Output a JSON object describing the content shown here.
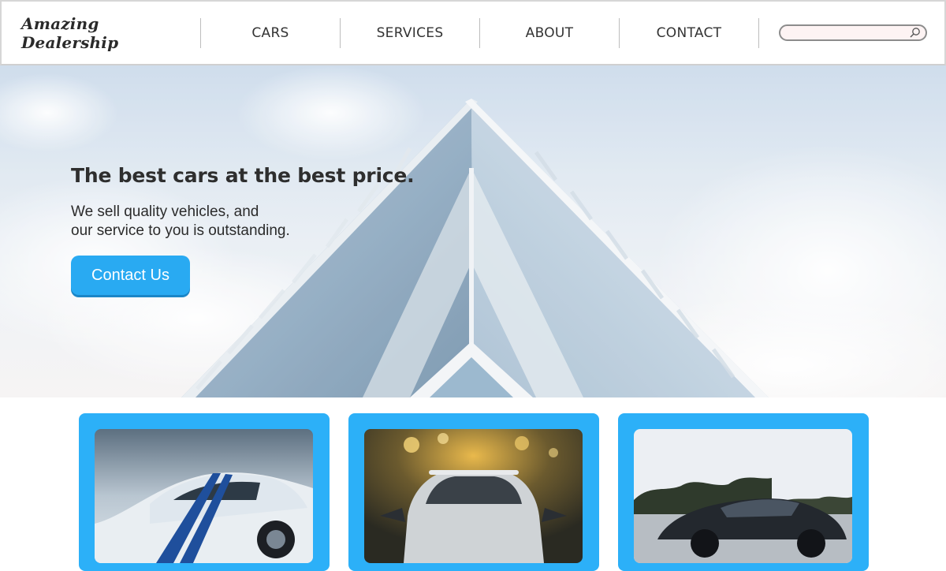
{
  "header": {
    "brand": "Amazing Dealership",
    "nav": [
      {
        "label": "CARS"
      },
      {
        "label": "SERVICES"
      },
      {
        "label": "ABOUT"
      },
      {
        "label": "CONTACT"
      }
    ],
    "search": {
      "value": "",
      "placeholder": "",
      "icon": "search-icon"
    }
  },
  "hero": {
    "title": "The best cars at the best price.",
    "subtitle_line1": "We sell quality vehicles, and",
    "subtitle_line2": "our service to you is outstanding.",
    "cta_label": "Contact Us",
    "background": "glass-building-photo"
  },
  "cards": [
    {
      "image": "blue-striped-sports-car-photo"
    },
    {
      "image": "silver-sedan-front-photo"
    },
    {
      "image": "dark-sports-car-side-photo"
    }
  ],
  "colors": {
    "accent": "#29aaf2",
    "card_frame": "#2cb0f8",
    "text": "#2e2e2e"
  }
}
